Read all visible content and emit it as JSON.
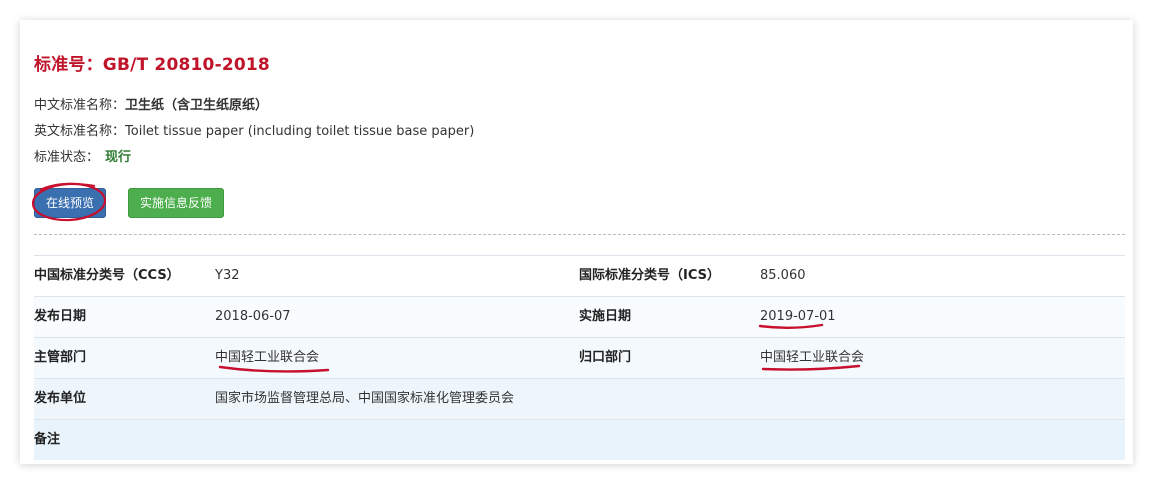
{
  "header": {
    "title": "标准号：GB/T 20810-2018"
  },
  "info": {
    "cn_name_label": "中文标准名称：",
    "cn_name_value": "卫生纸（含卫生纸原纸）",
    "en_name_label": "英文标准名称：",
    "en_name_value": "Toilet tissue paper (including toilet tissue base paper)",
    "status_label": "标准状态：",
    "status_value": "现行"
  },
  "buttons": {
    "preview": "在线预览",
    "feedback": "实施信息反馈"
  },
  "table": {
    "rows": [
      {
        "k1": "中国标准分类号（CCS）",
        "v1": "Y32",
        "k2": "国际标准分类号（ICS）",
        "v2": "85.060"
      },
      {
        "k1": "发布日期",
        "v1": "2018-06-07",
        "k2": "实施日期",
        "v2": "2019-07-01"
      },
      {
        "k1": "主管部门",
        "v1": "中国轻工业联合会",
        "k2": "归口部门",
        "v2": "中国轻工业联合会"
      },
      {
        "k1": "发布单位",
        "v1": "国家市场监督管理总局、中国国家标准化管理委员会",
        "k2": "",
        "v2": ""
      },
      {
        "k1": "备注",
        "v1": "",
        "k2": "",
        "v2": ""
      }
    ]
  },
  "colors": {
    "title": "#c0142a",
    "status": "#2e7d32",
    "preview_button": "#3a6fb0",
    "feedback_button": "#4cae4c",
    "annotation": "#c8102e"
  }
}
